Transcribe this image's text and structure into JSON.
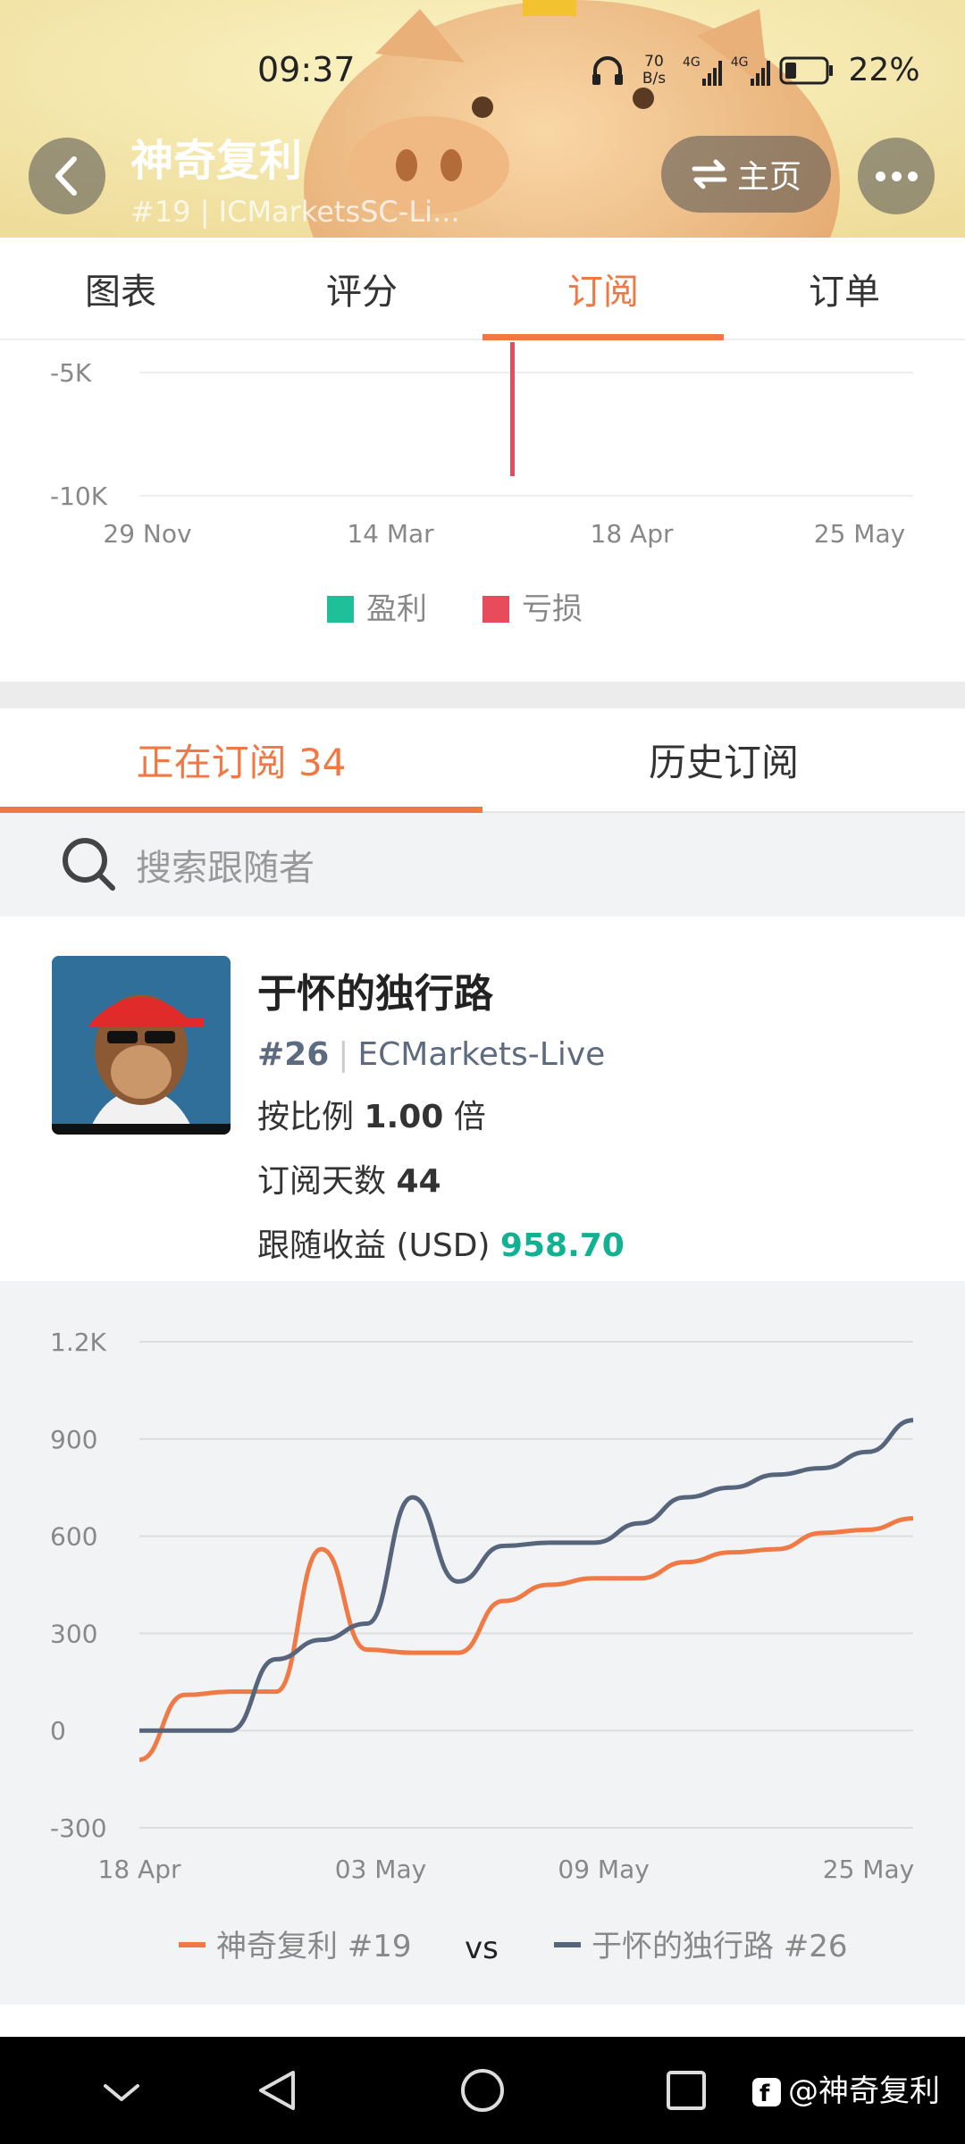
{
  "status_bar": {
    "time": "09:37",
    "net_speed_value": "70",
    "net_speed_unit": "B/s",
    "signal1": "4G",
    "signal2": "4G",
    "battery": "22%"
  },
  "header": {
    "title": "神奇复利",
    "subtitle": "#19 | ICMarketsSC-Li...",
    "home_label": "主页"
  },
  "tabs": [
    {
      "label": "图表",
      "active": false
    },
    {
      "label": "评分",
      "active": false
    },
    {
      "label": "订阅",
      "active": true
    },
    {
      "label": "订单",
      "active": false
    }
  ],
  "pl_chart": {
    "y_ticks": [
      "-5K",
      "-10K"
    ],
    "x_ticks": [
      "29 Nov",
      "14 Mar",
      "18 Apr",
      "25 May"
    ],
    "legend": {
      "profit": "盈利",
      "loss": "亏损"
    },
    "colors": {
      "profit": "#1fbf9a",
      "loss": "#e84c5c"
    }
  },
  "sub_tabs": {
    "current_label": "正在订阅 34",
    "history_label": "历史订阅"
  },
  "search": {
    "placeholder": "搜索跟随者"
  },
  "follower": {
    "name": "于怀的独行路",
    "rank": "#26",
    "server": "ECMarkets-Live",
    "ratio_label": "按比例",
    "ratio_value": "1.00",
    "ratio_unit": "倍",
    "days_label": "订阅天数",
    "days_value": "44",
    "profit_label": "跟随收益 (USD)",
    "profit_value": "958.70"
  },
  "compare_chart": {
    "legend_a": "神奇复利 #19",
    "vs": "vs",
    "legend_b": "于怀的独行路 #26",
    "colors": {
      "a": "#f07a45",
      "b": "#56657c"
    }
  },
  "chart_data": [
    {
      "type": "bar",
      "x_ticks": [
        "29 Nov",
        "14 Mar",
        "18 Apr",
        "25 May"
      ],
      "y_ticks": [
        "-5K",
        "-10K"
      ],
      "series": [
        {
          "name": "盈利",
          "values": []
        },
        {
          "name": "亏损",
          "values": [
            {
              "x": "Apr",
              "y": -8400
            }
          ]
        }
      ]
    },
    {
      "type": "line",
      "x": [
        "18 Apr",
        "20 Apr",
        "21 Apr",
        "24 Apr",
        "26 Apr",
        "28 Apr",
        "30 Apr",
        "02 May",
        "04 May",
        "06 May",
        "08 May",
        "10 May",
        "12 May",
        "14 May",
        "17 May",
        "20 May",
        "23 May",
        "25 May"
      ],
      "x_ticks": [
        "18 Apr",
        "03 May",
        "09 May",
        "25 May"
      ],
      "ylim": [
        -300,
        1200
      ],
      "y_ticks": [
        1200,
        900,
        600,
        300,
        0,
        -300
      ],
      "y_tick_labels": [
        "1.2K",
        "900",
        "600",
        "300",
        "0",
        "-300"
      ],
      "series": [
        {
          "name": "神奇复利 #19",
          "values": [
            -90,
            110,
            120,
            120,
            560,
            250,
            240,
            240,
            400,
            450,
            470,
            470,
            520,
            550,
            560,
            610,
            620,
            655
          ]
        },
        {
          "name": "于怀的独行路 #26",
          "values": [
            0,
            0,
            0,
            220,
            280,
            330,
            720,
            460,
            570,
            580,
            580,
            640,
            720,
            750,
            790,
            810,
            860,
            958
          ]
        }
      ]
    }
  ]
}
